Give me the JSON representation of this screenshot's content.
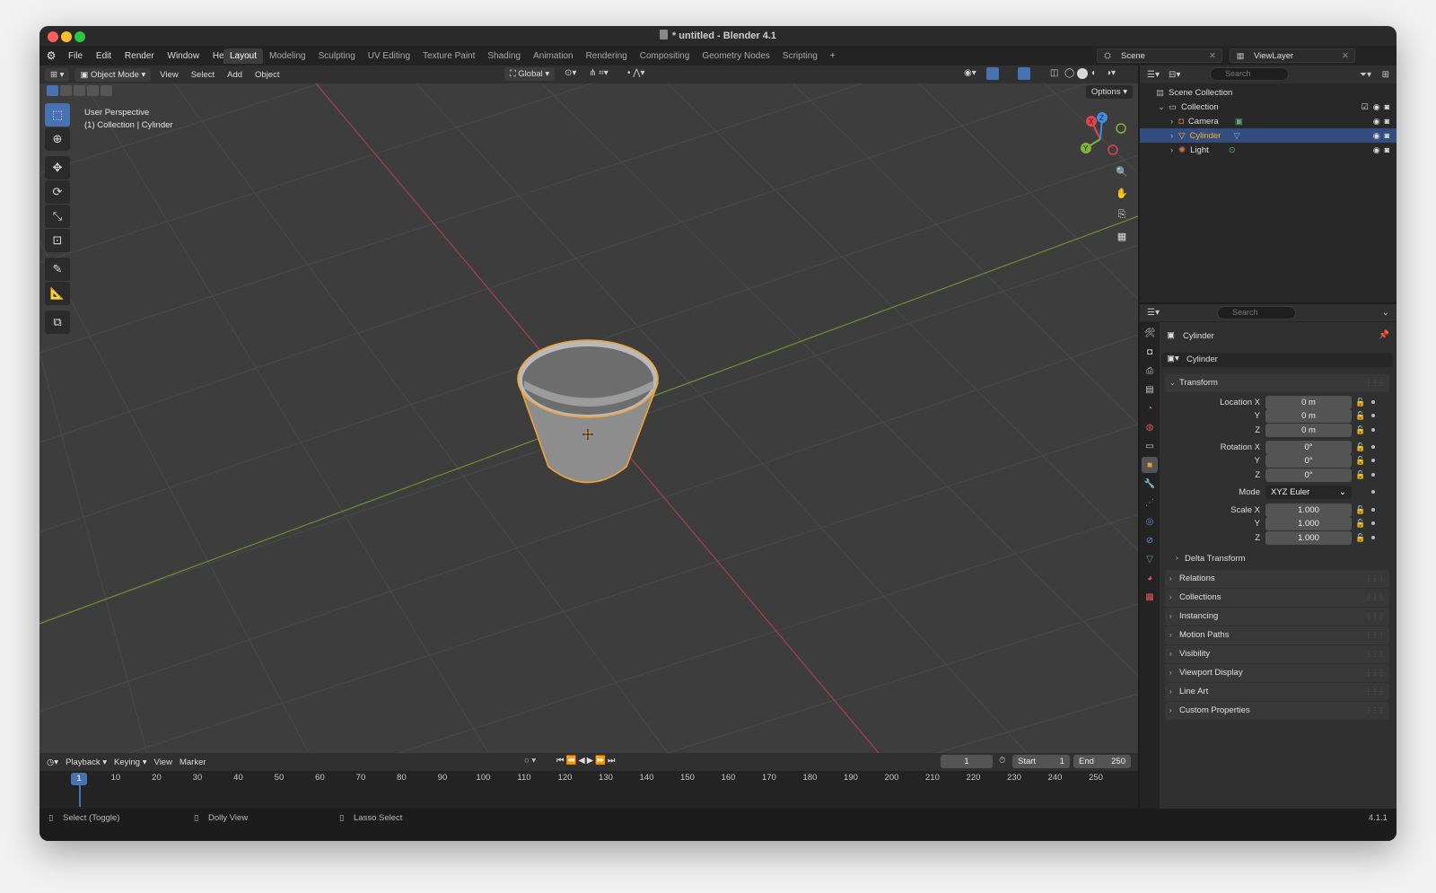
{
  "window": {
    "title": "* untitled - Blender 4.1"
  },
  "menu": [
    "File",
    "Edit",
    "Render",
    "Window",
    "Help"
  ],
  "workspaces": [
    {
      "label": "Layout",
      "active": true
    },
    {
      "label": "Modeling"
    },
    {
      "label": "Sculpting"
    },
    {
      "label": "UV Editing"
    },
    {
      "label": "Texture Paint"
    },
    {
      "label": "Shading"
    },
    {
      "label": "Animation"
    },
    {
      "label": "Rendering"
    },
    {
      "label": "Compositing"
    },
    {
      "label": "Geometry Nodes"
    },
    {
      "label": "Scripting"
    }
  ],
  "workspace_add": "+",
  "scene": {
    "name": "Scene",
    "view_layer": "ViewLayer"
  },
  "viewport": {
    "mode": "Object Mode",
    "menus": [
      "View",
      "Select",
      "Add",
      "Object"
    ],
    "transform_orientation": "Global",
    "options_label": "Options",
    "perspective": "User Perspective",
    "context": "(1) Collection | Cylinder",
    "gizmo": {
      "x": "X",
      "y": "Y",
      "z": "Z"
    }
  },
  "timeline": {
    "menus": [
      "Playback",
      "Keying",
      "View",
      "Marker"
    ],
    "current_frame": "1",
    "start_label": "Start",
    "start": "1",
    "end_label": "End",
    "end": "250",
    "ticks": [
      "1",
      "10",
      "20",
      "30",
      "40",
      "50",
      "60",
      "70",
      "80",
      "90",
      "100",
      "110",
      "120",
      "130",
      "140",
      "150",
      "160",
      "170",
      "180",
      "190",
      "200",
      "210",
      "220",
      "230",
      "240",
      "250"
    ]
  },
  "status": {
    "left": "Select (Toggle)",
    "middle": "Dolly View",
    "right": "Lasso Select",
    "version": "4.1.1"
  },
  "outliner": {
    "search_placeholder": "Search",
    "root": "Scene Collection",
    "collection": "Collection",
    "items": [
      {
        "name": "Camera",
        "color": "#c27a4a"
      },
      {
        "name": "Cylinder",
        "color": "#ffaf29",
        "selected": true
      },
      {
        "name": "Light",
        "color": "#c27a4a"
      }
    ]
  },
  "properties": {
    "search_placeholder": "Search",
    "object_name": "Cylinder",
    "data_name": "Cylinder",
    "transform_label": "Transform",
    "location": {
      "label": "Location X",
      "x": "0 m",
      "y": "0 m",
      "z": "0 m"
    },
    "rotation": {
      "label": "Rotation X",
      "x": "0°",
      "y": "0°",
      "z": "0°"
    },
    "mode": {
      "label": "Mode",
      "value": "XYZ Euler"
    },
    "scale": {
      "label": "Scale X",
      "x": "1.000",
      "y": "1.000",
      "z": "1.000"
    },
    "axis_y": "Y",
    "axis_z": "Z",
    "delta_transform": "Delta Transform",
    "panels": [
      "Relations",
      "Collections",
      "Instancing",
      "Motion Paths",
      "Visibility",
      "Viewport Display",
      "Line Art",
      "Custom Properties"
    ]
  },
  "colors": {
    "accent": "#4772b3",
    "selected_object": "#ffaf29",
    "x_axis": "#e0434f",
    "y_axis": "#7fb33a"
  }
}
